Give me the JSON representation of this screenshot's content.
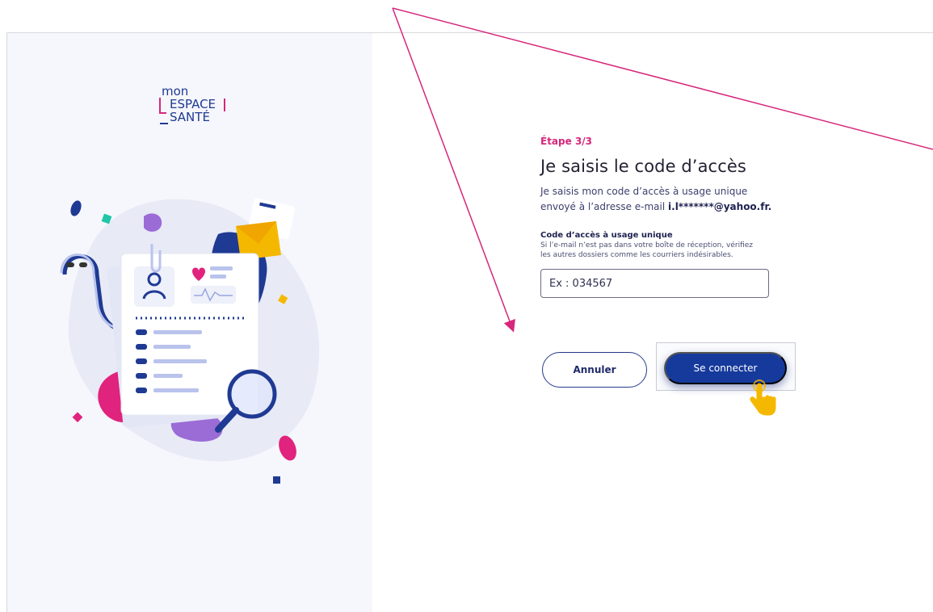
{
  "form": {
    "step": "Étape 3/3",
    "title": "Je saisis le code d’accès",
    "description_prefix": "Je saisis mon code d’accès à usage unique envoyé à l’adresse e-mail ",
    "email": "i.l*******@yahoo.fr.",
    "field_label": "Code d’accès à usage unique",
    "field_help": "Si l’e-mail n’est pas dans votre boîte de réception, vérifiez les autres dossiers comme les courriers indésirables.",
    "input_placeholder": "Ex : 034567",
    "input_value": ""
  },
  "buttons": {
    "cancel": "Annuler",
    "connect": "Se connecter"
  },
  "logo": {
    "line1": "mon",
    "line2": "ESPACE",
    "line3": "SANTÉ"
  },
  "colors": {
    "accent_pink": "#d6277b",
    "primary_blue": "#163a9c",
    "annotation_line": "#d6277b",
    "cursor": "#f5b800"
  },
  "icons": {
    "cursor": "hand-pointer-icon",
    "arrow": "annotation-arrow"
  }
}
